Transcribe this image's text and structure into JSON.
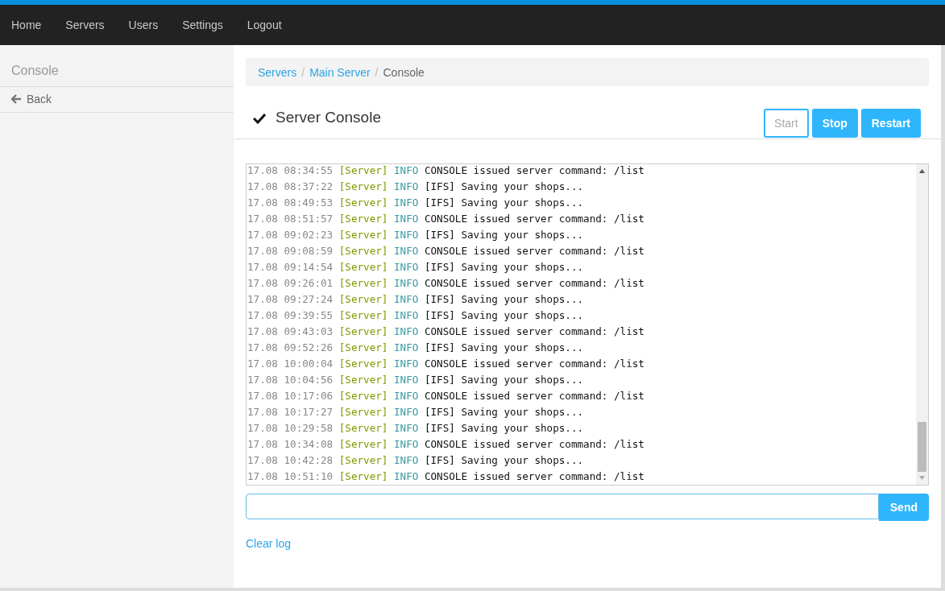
{
  "nav": {
    "items": [
      {
        "label": "Home"
      },
      {
        "label": "Servers"
      },
      {
        "label": "Users"
      },
      {
        "label": "Settings"
      },
      {
        "label": "Logout"
      }
    ]
  },
  "sidebar": {
    "title": "Console",
    "back": "Back"
  },
  "breadcrumb": [
    {
      "label": "Servers",
      "link": true
    },
    {
      "label": "Main Server",
      "link": true
    },
    {
      "label": "Console",
      "link": false
    }
  ],
  "breadcrumb_separator": "/",
  "header": {
    "title": "Server Console",
    "status_ok": true
  },
  "buttons": [
    {
      "label": "Start",
      "disabled": true
    },
    {
      "label": "Stop",
      "disabled": false
    },
    {
      "label": "Restart",
      "disabled": false
    }
  ],
  "log": [
    {
      "time": "17.08 08:34:55",
      "source": "[Server]",
      "level": "INFO",
      "message": "CONSOLE issued server command: /list"
    },
    {
      "time": "17.08 08:37:22",
      "source": "[Server]",
      "level": "INFO",
      "message": "[IFS] Saving your shops..."
    },
    {
      "time": "17.08 08:49:53",
      "source": "[Server]",
      "level": "INFO",
      "message": "[IFS] Saving your shops..."
    },
    {
      "time": "17.08 08:51:57",
      "source": "[Server]",
      "level": "INFO",
      "message": "CONSOLE issued server command: /list"
    },
    {
      "time": "17.08 09:02:23",
      "source": "[Server]",
      "level": "INFO",
      "message": "[IFS] Saving your shops..."
    },
    {
      "time": "17.08 09:08:59",
      "source": "[Server]",
      "level": "INFO",
      "message": "CONSOLE issued server command: /list"
    },
    {
      "time": "17.08 09:14:54",
      "source": "[Server]",
      "level": "INFO",
      "message": "[IFS] Saving your shops..."
    },
    {
      "time": "17.08 09:26:01",
      "source": "[Server]",
      "level": "INFO",
      "message": "CONSOLE issued server command: /list"
    },
    {
      "time": "17.08 09:27:24",
      "source": "[Server]",
      "level": "INFO",
      "message": "[IFS] Saving your shops..."
    },
    {
      "time": "17.08 09:39:55",
      "source": "[Server]",
      "level": "INFO",
      "message": "[IFS] Saving your shops..."
    },
    {
      "time": "17.08 09:43:03",
      "source": "[Server]",
      "level": "INFO",
      "message": "CONSOLE issued server command: /list"
    },
    {
      "time": "17.08 09:52:26",
      "source": "[Server]",
      "level": "INFO",
      "message": "[IFS] Saving your shops..."
    },
    {
      "time": "17.08 10:00:04",
      "source": "[Server]",
      "level": "INFO",
      "message": "CONSOLE issued server command: /list"
    },
    {
      "time": "17.08 10:04:56",
      "source": "[Server]",
      "level": "INFO",
      "message": "[IFS] Saving your shops..."
    },
    {
      "time": "17.08 10:17:06",
      "source": "[Server]",
      "level": "INFO",
      "message": "CONSOLE issued server command: /list"
    },
    {
      "time": "17.08 10:17:27",
      "source": "[Server]",
      "level": "INFO",
      "message": "[IFS] Saving your shops..."
    },
    {
      "time": "17.08 10:29:58",
      "source": "[Server]",
      "level": "INFO",
      "message": "[IFS] Saving your shops..."
    },
    {
      "time": "17.08 10:34:08",
      "source": "[Server]",
      "level": "INFO",
      "message": "CONSOLE issued server command: /list"
    },
    {
      "time": "17.08 10:42:28",
      "source": "[Server]",
      "level": "INFO",
      "message": "[IFS] Saving your shops..."
    },
    {
      "time": "17.08 10:51:10",
      "source": "[Server]",
      "level": "INFO",
      "message": "CONSOLE issued server command: /list"
    }
  ],
  "command": {
    "send": "Send"
  },
  "clear_log": "Clear log"
}
